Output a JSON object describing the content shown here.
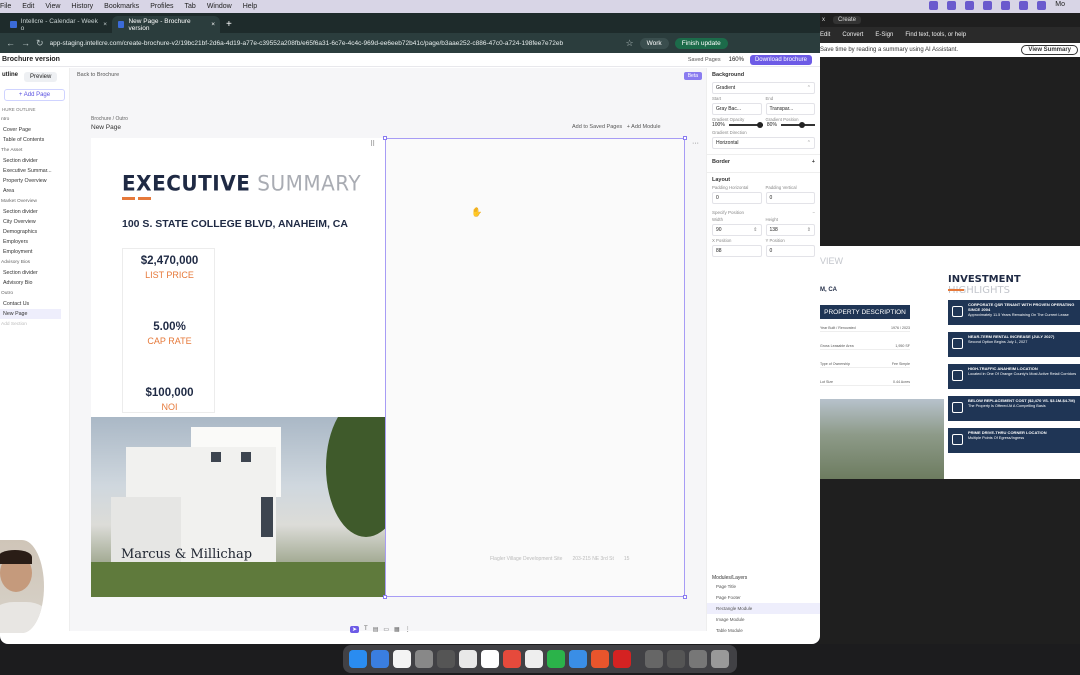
{
  "menubar": {
    "items": [
      "File",
      "Edit",
      "View",
      "History",
      "Bookmarks",
      "Profiles",
      "Tab",
      "Window",
      "Help"
    ],
    "right_label": "Mo"
  },
  "browser": {
    "tabs": [
      {
        "label": "Intellcre - Calendar - Week o",
        "active": false
      },
      {
        "label": "New Page - Brochure version",
        "active": true
      }
    ],
    "url": "app-staging.intellcre.com/create-brochure-v2/19bc21bf-2d6a-4d19-a77e-c39552a208fb/e65f6a31-6c7e-4c4c-969d-ee6eeb72b41c/page/b3aae252-c886-47c0-a724-198fee7e72eb",
    "profile": "Work",
    "update_label": "Finish update"
  },
  "app": {
    "title": "Brochure version",
    "saved_pages": "Saved Pages",
    "zoom": "160%",
    "download_label": "Download brochure",
    "back_label": "Back to Brochure",
    "beta_label": "Beta",
    "breadcrumb": "Brochure  /  Outro",
    "page_title": "New Page",
    "add_to_saved": "Add to Saved Pages",
    "add_module": "+ Add Module"
  },
  "left_panel": {
    "tab_outline": "utline",
    "tab_preview": "Preview",
    "add_page": "+ Add Page",
    "header": "HURE OUTLINE",
    "sections": [
      {
        "title": "ntro",
        "items": [
          "Cover Page",
          "Table of Contents"
        ]
      },
      {
        "title": "The Asset",
        "items": [
          "Section divider",
          "Executive Summar...",
          "Property Overview",
          "Area"
        ]
      },
      {
        "title": "Market Overview",
        "items": [
          "Section divider",
          "City Overview",
          "Demographics",
          "Employers",
          "Employment"
        ]
      },
      {
        "title": "Advisory Bios",
        "items": [
          "Section divider",
          "Advisory Bio"
        ]
      },
      {
        "title": "Outro",
        "items": [
          "Contact Us",
          "New Page"
        ]
      }
    ],
    "add_section": "Add Section"
  },
  "page": {
    "heading_main": "EXECUTIVE",
    "heading_light": " SUMMARY",
    "address": "100 S. STATE COLLEGE BLVD, ANAHEIM, CA",
    "stats": [
      {
        "value": "$2,470,000",
        "label": "LIST PRICE"
      },
      {
        "value": "5.00%",
        "label": "CAP RATE"
      },
      {
        "value": "$100,000",
        "label": "NOI"
      }
    ],
    "logo": "Marcus & Millichap",
    "footer": [
      "Flagler Village Development Site",
      "203-215 NE 3rd St",
      "15"
    ]
  },
  "right_panel": {
    "background_label": "Background",
    "bg_type": "Gradient",
    "start_label": "Start",
    "end_label": "End",
    "start_value": "Gray Bac...",
    "end_value": "Transpar...",
    "start_opacity_label": "Gradient Opacity",
    "start_opacity": "100%",
    "end_position_label": "Gradient Position",
    "end_opacity": "80%",
    "direction_label": "Gradient Direction",
    "direction": "Horizontal",
    "border_label": "Border",
    "layout_label": "Layout",
    "pad_h_label": "Padding Horizontal",
    "pad_v_label": "Padding Vertical",
    "pad_h": "0",
    "pad_v": "0",
    "specify_label": "Specify Position",
    "width_label": "Width",
    "height_label": "Height",
    "width": "90",
    "height": "138",
    "xpos_label": "X Position",
    "ypos_label": "Y Position",
    "xpos": "88",
    "ypos": "0",
    "modules_label": "Modules/Layers",
    "layers": [
      "Page Title",
      "Page Footer",
      "Rectangle Module",
      "Image Module",
      "Table Module"
    ],
    "selected_layer": 2
  },
  "acrobat": {
    "tab_label": "x",
    "create": "Create",
    "tools": [
      "Edit",
      "Convert",
      "E-Sign",
      "Find text, tools, or help"
    ],
    "ai_text": "Save time by reading a summary using AI Assistant.",
    "ai_button": "View Summary",
    "doc": {
      "view_text": "VIEW",
      "city": "M, CA",
      "heading_main": "INVESTMENT",
      "heading_light": " HIGHLIGHTS",
      "property_description": "PROPERTY DESCRIPTION",
      "pd_rows": [
        {
          "k": "Year Built / Renovated",
          "v": "1976 / 2023"
        },
        {
          "k": "Gross Leasable Area",
          "v": "1,950 SF"
        },
        {
          "k": "Type of Ownership",
          "v": "Fee Simple"
        },
        {
          "k": "Lot Size",
          "v": "0.44 Acres"
        }
      ],
      "cards": [
        {
          "title": "CORPORATE QSR TENANT WITH PROVEN OPERATING SINCE 2004",
          "body": "Approximately 11.5 Years Remaining On The Current Lease"
        },
        {
          "title": "NEAR-TERM RENTAL INCREASE (JULY 2027)",
          "body": "Second Option Begins July 1, 2027"
        },
        {
          "title": "HIGH-TRAFFIC ANAHEIM LOCATION",
          "body": "Located in One Of Orange County's Most Active Retail Corridors"
        },
        {
          "title": "BELOW REPLACEMENT COST ($2,470 VS. $3.1M-$4.7M)",
          "body": "The Property Is Offered At A Compelling Basis"
        },
        {
          "title": "PRIME DRIVE-THRU CORNER LOCATION",
          "body": "Multiple Points Of Egress/Ingress"
        }
      ]
    }
  }
}
